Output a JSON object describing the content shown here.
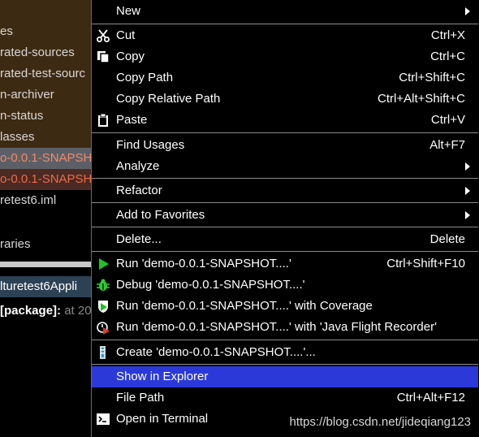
{
  "tree": {
    "rows": [
      "es",
      "rated-sources",
      "rated-test-sourc",
      "n-archiver",
      "n-status",
      "lasses",
      "o-0.0.1-SNAPSHO",
      "o-0.0.1-SNAPSH",
      "retest6.iml",
      "raries",
      "lturetest6Appli"
    ],
    "package_label": "[package]:",
    "package_suffix": "at 20"
  },
  "menu": {
    "new": {
      "label": "New"
    },
    "cut": {
      "label": "Cut",
      "shortcut": "Ctrl+X"
    },
    "copy": {
      "label": "Copy",
      "shortcut": "Ctrl+C"
    },
    "copy_path": {
      "label": "Copy Path",
      "shortcut": "Ctrl+Shift+C"
    },
    "copy_relative_path": {
      "label": "Copy Relative Path",
      "shortcut": "Ctrl+Alt+Shift+C"
    },
    "paste": {
      "label": "Paste",
      "shortcut": "Ctrl+V"
    },
    "find_usages": {
      "label": "Find Usages",
      "shortcut": "Alt+F7"
    },
    "analyze": {
      "label": "Analyze"
    },
    "refactor": {
      "label": "Refactor"
    },
    "add_to_favorites": {
      "label": "Add to Favorites"
    },
    "delete": {
      "label": "Delete...",
      "shortcut": "Delete"
    },
    "run": {
      "label": "Run 'demo-0.0.1-SNAPSHOT....'",
      "shortcut": "Ctrl+Shift+F10"
    },
    "debug": {
      "label": "Debug 'demo-0.0.1-SNAPSHOT....'"
    },
    "run_coverage": {
      "label": "Run 'demo-0.0.1-SNAPSHOT....' with Coverage"
    },
    "run_jfr": {
      "label": "Run 'demo-0.0.1-SNAPSHOT....' with 'Java Flight Recorder'"
    },
    "create": {
      "label": "Create 'demo-0.0.1-SNAPSHOT....'..."
    },
    "show_in_explorer": {
      "label": "Show in Explorer"
    },
    "file_path": {
      "label": "File Path",
      "shortcut": "Ctrl+Alt+F12"
    },
    "open_in_terminal": {
      "label": "Open in Terminal"
    }
  },
  "watermark": "https://blog.csdn.net/jideqiang123",
  "colors": {
    "highlight": "#2b39d9",
    "run_green": "#21c321",
    "debug_green": "#2ecc2e",
    "jfr_red": "#e23b2a"
  }
}
